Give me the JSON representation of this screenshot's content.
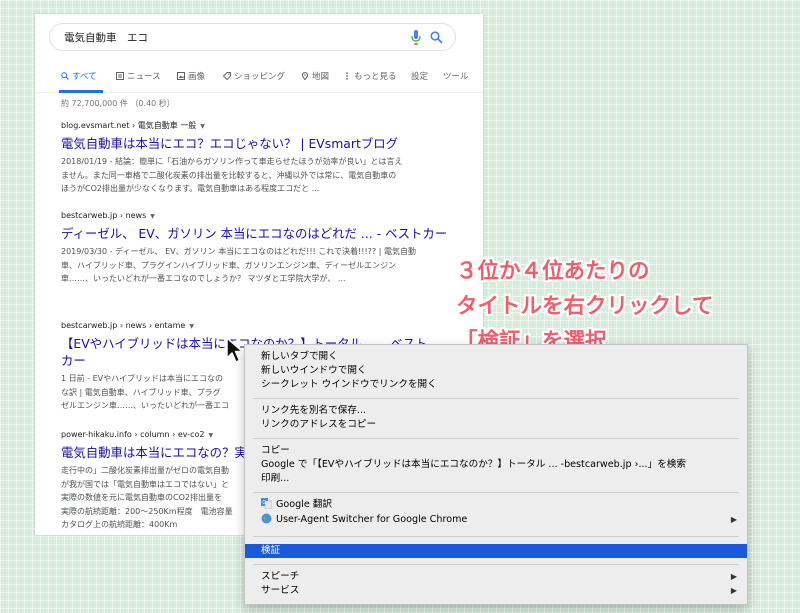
{
  "search": {
    "query": "電気自動車　エコ"
  },
  "tabs": [
    {
      "label": "すべて",
      "icon": "search-icon"
    },
    {
      "label": "ニュース",
      "icon": "news-icon"
    },
    {
      "label": "画像",
      "icon": "image-icon"
    },
    {
      "label": "ショッピング",
      "icon": "tag-icon"
    },
    {
      "label": "地図",
      "icon": "map-pin-icon"
    },
    {
      "label": "もっと見る",
      "icon": "more-icon"
    },
    {
      "label": "設定",
      "icon": ""
    },
    {
      "label": "ツール",
      "icon": ""
    }
  ],
  "stats": "約 72,700,000 件 （0.40 秒）",
  "results": [
    {
      "cite": "blog.evsmart.net › 電気自動車 一般",
      "title": "電気自動車は本当にエコ？エコじゃない？ | EVsmartブログ",
      "snippet1": "2018/01/19 - 結論：簡単に「石油からガソリン作って車走らせたほうが効率が良い」とは言え",
      "snippet2": "ません。また同一車格で二酸化炭素の排出量を比較すると、沖縄以外では常に、電気自動車の",
      "snippet3": "ほうがCO2排出量が少なくなります。電気自動車はある程度エコだと ..."
    },
    {
      "cite": "bestcarweb.jp › news",
      "title": "ディーゼル、 EV、ガソリン 本当にエコなのはどれだ ... - ベストカー",
      "snippet1": "2019/03/30 - ディーゼル、 EV、ガソリン 本当にエコなのはどれだ!!! これで決着!!!?? | 電気自動",
      "snippet2": "車、ハイブリッド車、プラグインハイブリッド車、ガソリンエンジン車、ディーゼルエンジン",
      "snippet3": "車……、いったいどれが一番エコなのでしょうか？ マツダと工学院大学が、 ..."
    },
    {
      "cite": "bestcarweb.jp › news › entame",
      "title": "【EVやハイブリッドは本当にエコなのか？】トータル ... - ベスト",
      "title2": "カー",
      "snippet1": "1 日前 - EVやハイブリッドは本当にエコなの",
      "snippet2": "な訳 | 電気自動車、ハイブリッド車、プラグ",
      "snippet3": "ゼルエンジン車……、いったいどれが一番エコ"
    },
    {
      "cite": "power-hikaku.info › column › ev-co2",
      "title": "電気自動車は本当にエコなの？実",
      "snippet1": "走行中の」二酸化炭素排出量がゼロの電気自動",
      "snippet2": "が我が国では「電気自動車はエコではない」と",
      "snippet3": "実際の数値を元に電気自動車のCO2排出量を",
      "snippet4": "実際の航続距離：200～250Km程度　電池容量",
      "snippet5": "カタログ上の航続距離：400Km"
    }
  ],
  "annotation": {
    "line1": "３位か４位あたりの",
    "line2": "タイトルを右クリックして",
    "line3": "「検証」を選択"
  },
  "context_menu": {
    "items": [
      {
        "label": "新しいタブで開く"
      },
      {
        "label": "新しいウインドウで開く"
      },
      {
        "label": "シークレット ウインドウでリンクを開く"
      },
      {
        "label": "リンク先を別名で保存..."
      },
      {
        "label": "リンクのアドレスをコピー"
      },
      {
        "label": "コピー"
      },
      {
        "label": "Google で「【EVやハイブリッドは本当にエコなのか？】トータル ... -bestcarweb.jp ›...」を検索"
      },
      {
        "label": "印刷..."
      },
      {
        "label": "Google 翻訳"
      },
      {
        "label": "User-Agent Switcher for Google Chrome"
      },
      {
        "label": "検証"
      },
      {
        "label": "スピーチ"
      },
      {
        "label": "サービス"
      }
    ]
  },
  "colors": {
    "link": "#1a0dab",
    "accent_blue": "#1a73e8",
    "menu_selection": "#1a5ad9",
    "annotation": "#f25c6b",
    "background": "#d7ecdb"
  }
}
